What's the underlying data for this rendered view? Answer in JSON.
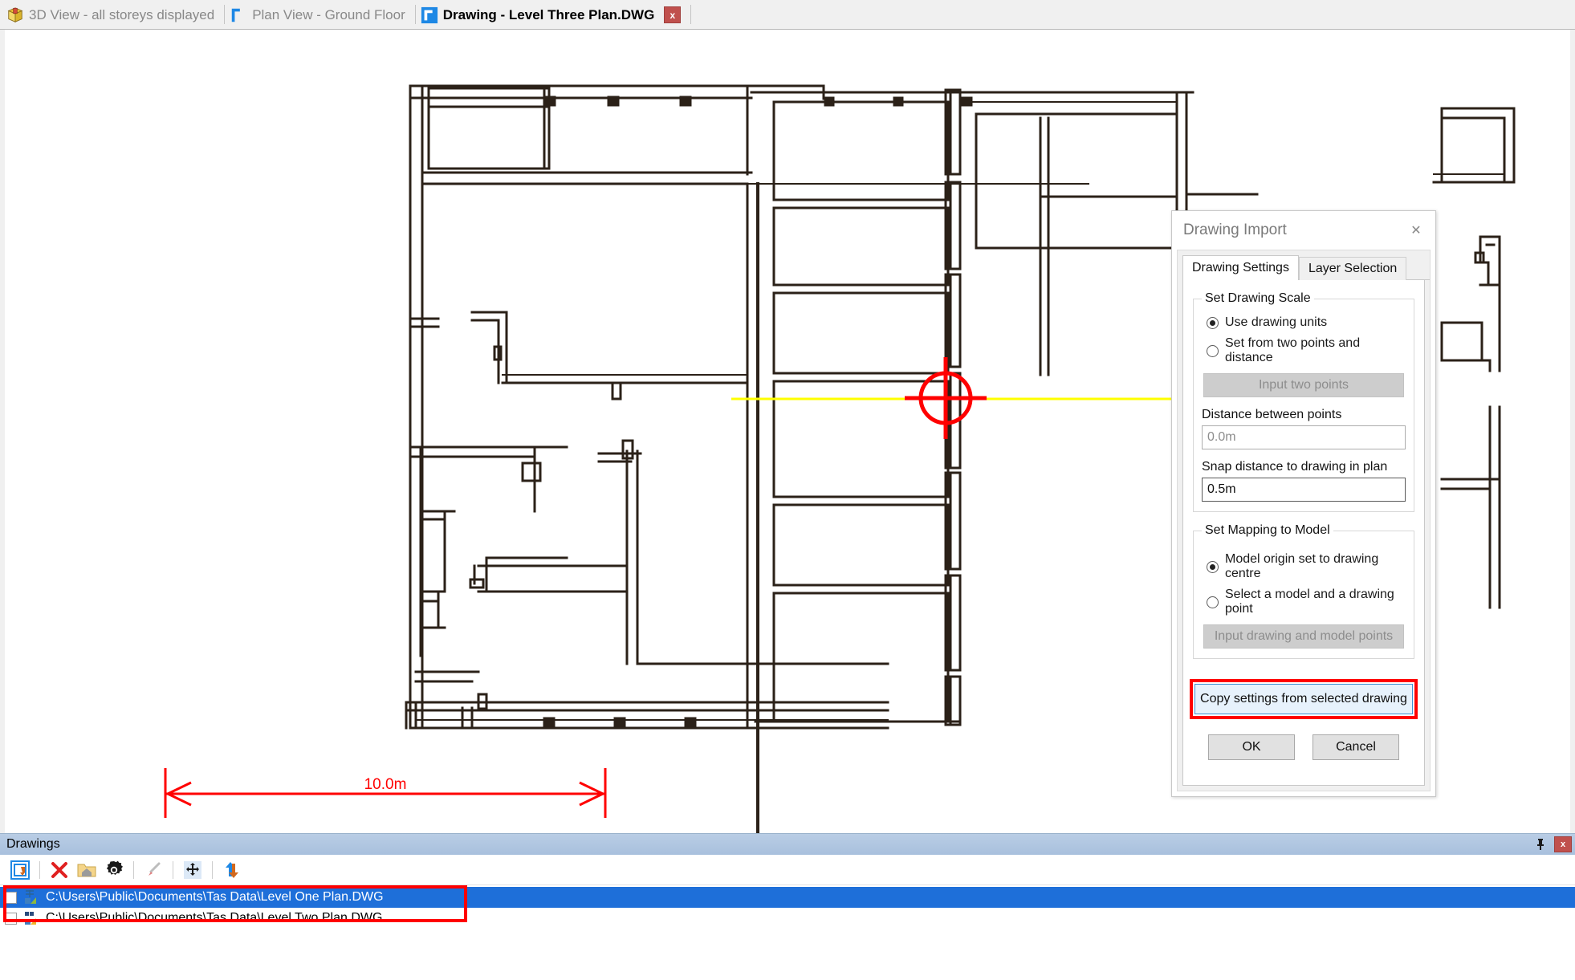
{
  "tabs": [
    {
      "label": "3D View - all storeys displayed",
      "icon": "cube-icon",
      "active": false,
      "closable": false
    },
    {
      "label": "Plan View - Ground Floor",
      "icon": "plan-icon",
      "active": false,
      "closable": false
    },
    {
      "label": "Drawing - Level Three Plan.DWG",
      "icon": "drawing-icon",
      "active": true,
      "closable": true,
      "close_label": "x"
    }
  ],
  "canvas": {
    "scale_bar_label": "10.0m",
    "crosshair_color": "#ff0000",
    "axis_color": "#ffff00",
    "wall_color": "#2b2118"
  },
  "dialog": {
    "title": "Drawing Import",
    "close_label": "✕",
    "tabs": [
      {
        "label": "Drawing Settings",
        "active": true
      },
      {
        "label": "Layer Selection",
        "active": false
      }
    ],
    "scale_group": {
      "legend": "Set Drawing Scale",
      "options": [
        {
          "label": "Use drawing units",
          "selected": true
        },
        {
          "label": "Set from two points and distance",
          "selected": false
        }
      ],
      "input_points_button": "Input two points",
      "distance_label": "Distance between points",
      "distance_value": "0.0m"
    },
    "snap_label": "Snap distance to drawing in plan",
    "snap_value": "0.5m",
    "mapping_group": {
      "legend": "Set Mapping to Model",
      "options": [
        {
          "label": "Model origin set to drawing centre",
          "selected": true
        },
        {
          "label": "Select a model and a drawing point",
          "selected": false
        }
      ],
      "input_points_button": "Input drawing and model points"
    },
    "copy_button": "Copy settings from selected drawing",
    "ok_button": "OK",
    "cancel_button": "Cancel"
  },
  "panel": {
    "title": "Drawings",
    "close_label": "x",
    "toolbar": [
      {
        "name": "import-drawing-icon"
      },
      {
        "name": "delete-drawing-icon"
      },
      {
        "name": "folder-home-icon"
      },
      {
        "name": "settings-gear-icon"
      },
      {
        "name": "paintbrush-icon"
      },
      {
        "name": "move-icon"
      },
      {
        "name": "export-arrows-icon"
      }
    ],
    "rows": [
      {
        "path": "C:\\Users\\Public\\Documents\\Tas Data\\Level One Plan.DWG",
        "selected": true,
        "checked": false
      },
      {
        "path": "C:\\Users\\Public\\Documents\\Tas Data\\Level Two Plan.DWG",
        "selected": false,
        "checked": false
      }
    ]
  },
  "colors": {
    "selection_blue": "#1e6fd9",
    "annotation_red": "#ff0000",
    "panel_header": "#a8c0dd",
    "close_red": "#c0504d"
  }
}
